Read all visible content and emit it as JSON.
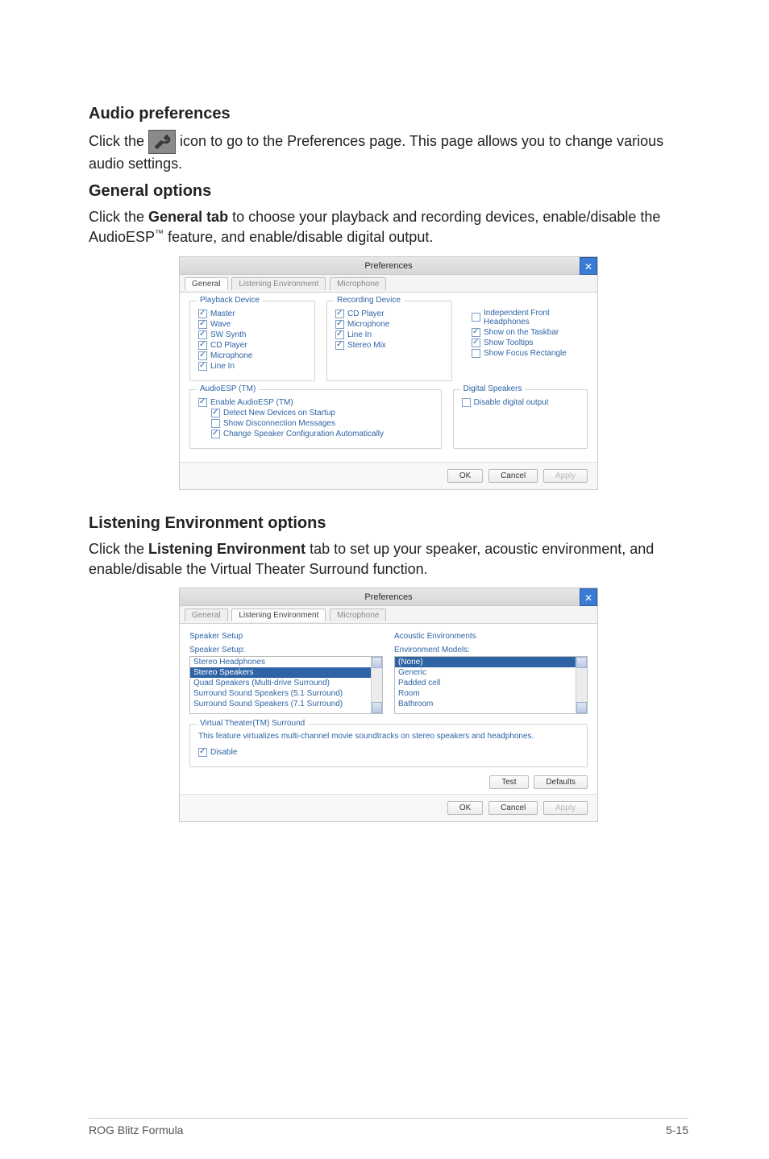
{
  "headings": {
    "audio_prefs": "Audio preferences",
    "general_options": "General options",
    "listening_env_options": "Listening Environment options"
  },
  "paragraphs": {
    "audio_prefs_pre": "Click the ",
    "audio_prefs_post": " icon to go to the Preferences page. This page allows you to change various audio settings.",
    "general_pre": "Click the ",
    "general_bold": "General tab",
    "general_post": " to choose your playback and recording devices, enable/disable the AudioESP",
    "general_tm": "™",
    "general_tail": " feature, and enable/disable digital output.",
    "listen_pre": "Click the ",
    "listen_bold": "Listening Environment",
    "listen_post": " tab to set up your speaker, acoustic environment, and enable/disable the Virtual Theater Surround function."
  },
  "window1": {
    "title": "Preferences",
    "tabs": [
      "General",
      "Listening Environment",
      "Microphone"
    ],
    "groups": {
      "playback": {
        "title": "Playback Device",
        "items": [
          {
            "label": "Master",
            "checked": true
          },
          {
            "label": "Wave",
            "checked": true
          },
          {
            "label": "SW Synth",
            "checked": true
          },
          {
            "label": "CD Player",
            "checked": true
          },
          {
            "label": "Microphone",
            "checked": true
          },
          {
            "label": "Line In",
            "checked": true
          }
        ]
      },
      "recording": {
        "title": "Recording Device",
        "items": [
          {
            "label": "CD Player",
            "checked": true
          },
          {
            "label": "Microphone",
            "checked": true
          },
          {
            "label": "Line In",
            "checked": true
          },
          {
            "label": "Stereo Mix",
            "checked": true
          }
        ]
      },
      "misc": {
        "items": [
          {
            "label": "Independent Front Headphones",
            "checked": false
          },
          {
            "label": "Show on the Taskbar",
            "checked": true
          },
          {
            "label": "Show Tooltips",
            "checked": true
          },
          {
            "label": "Show Focus Rectangle",
            "checked": false
          }
        ]
      },
      "audioesp": {
        "title": "AudioESP (TM)",
        "items": [
          {
            "label": "Enable AudioESP (TM)",
            "checked": true,
            "indent": 0
          },
          {
            "label": "Detect New Devices on Startup",
            "checked": true,
            "indent": 1
          },
          {
            "label": "Show Disconnection Messages",
            "checked": false,
            "indent": 1
          },
          {
            "label": "Change Speaker Configuration Automatically",
            "checked": true,
            "indent": 1
          }
        ]
      },
      "digital": {
        "title": "Digital Speakers",
        "items": [
          {
            "label": "Disable digital output",
            "checked": false
          }
        ]
      }
    },
    "buttons": {
      "ok": "OK",
      "cancel": "Cancel",
      "apply": "Apply"
    }
  },
  "window2": {
    "title": "Preferences",
    "tabs": [
      "General",
      "Listening Environment",
      "Microphone"
    ],
    "speaker_setup": {
      "title": "Speaker Setup",
      "sub": "Speaker Setup:",
      "items": [
        "Stereo Headphones",
        "Stereo Speakers",
        "Quad Speakers (Multi-drive Surround)",
        "Surround Sound Speakers (5.1 Surround)",
        "Surround Sound Speakers (7.1 Surround)"
      ],
      "selected_index": 1
    },
    "acoustic": {
      "title": "Acoustic Environments",
      "sub": "Environment Models:",
      "items": [
        "(None)",
        "Generic",
        "Padded cell",
        "Room",
        "Bathroom"
      ],
      "selected_index": 0
    },
    "virtual": {
      "title": "Virtual Theater(TM) Surround",
      "desc": "This feature virtualizes multi-channel movie soundtracks on stereo speakers and headphones.",
      "disable": {
        "label": "Disable",
        "checked": true
      }
    },
    "buttons": {
      "test": "Test",
      "defaults": "Defaults",
      "ok": "OK",
      "cancel": "Cancel",
      "apply": "Apply"
    }
  },
  "footer": {
    "left": "ROG Blitz Formula",
    "right": "5-15"
  }
}
